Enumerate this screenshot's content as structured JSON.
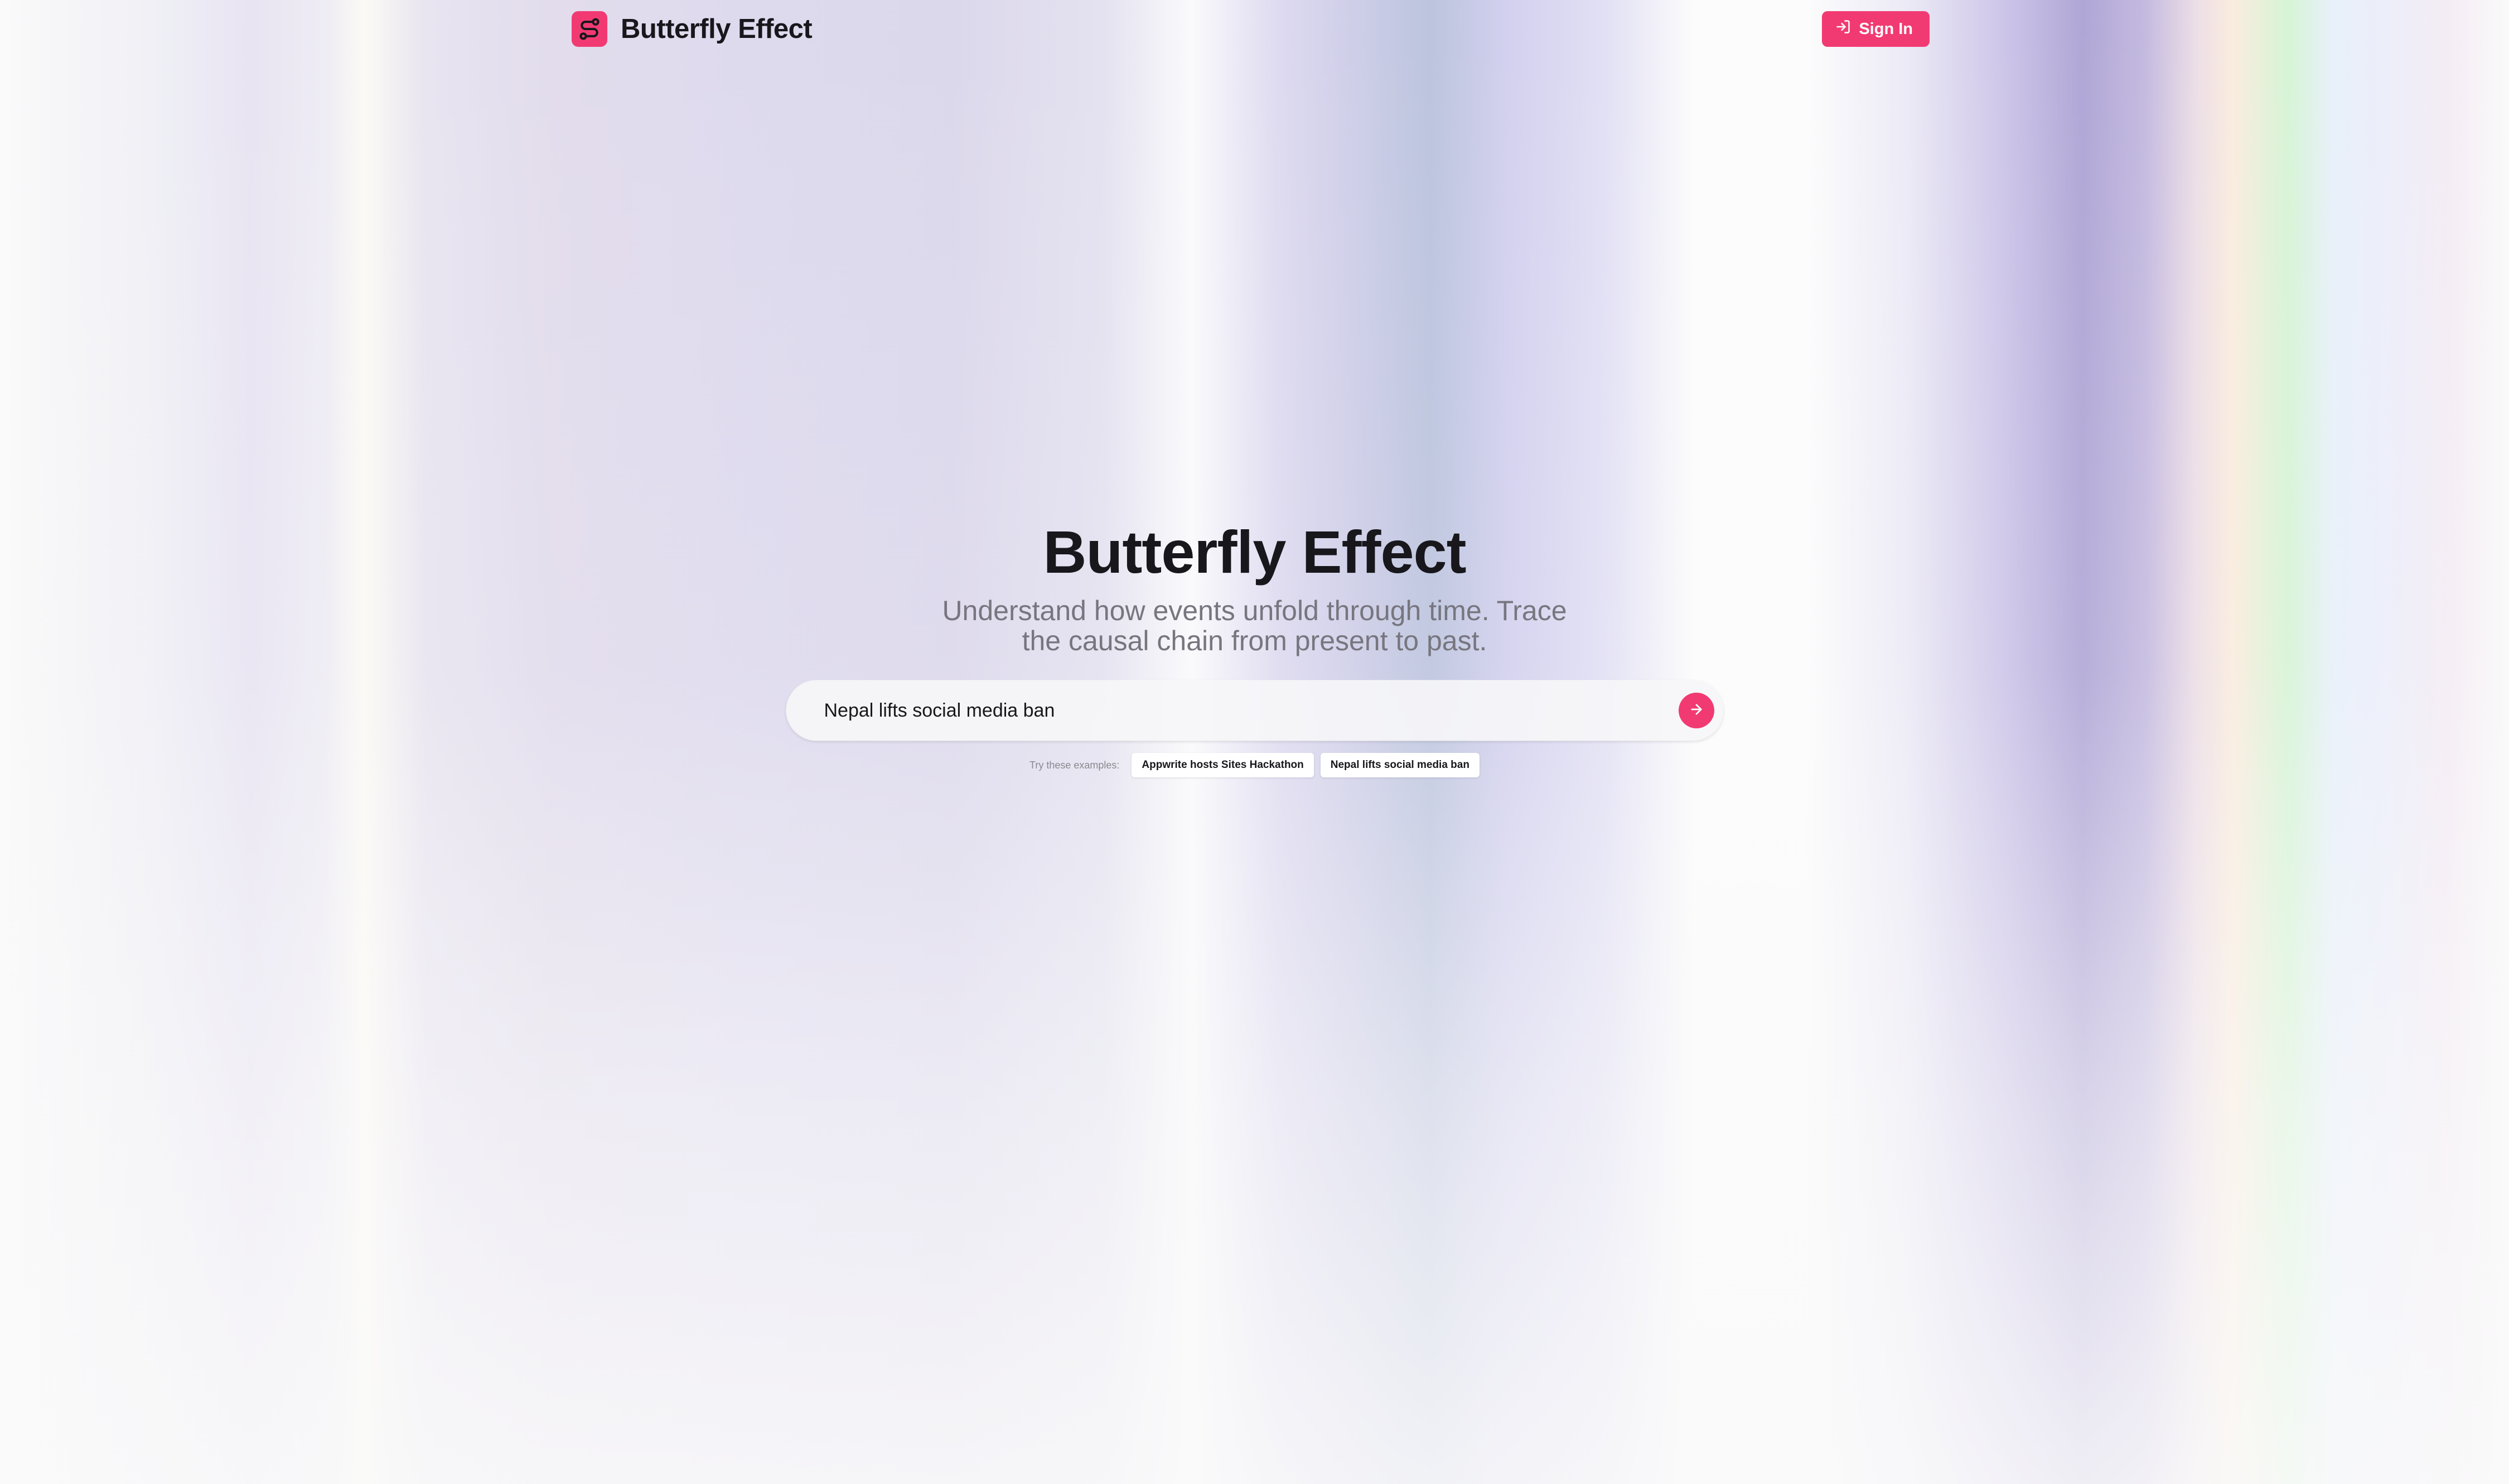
{
  "header": {
    "brand_name": "Butterfly Effect",
    "signin_label": "Sign In"
  },
  "hero": {
    "title": "Butterfly Effect",
    "subtitle": "Understand how events unfold through time. Trace the causal chain from present to past."
  },
  "search": {
    "value": "Nepal lifts social media ban",
    "placeholder": ""
  },
  "examples": {
    "label": "Try these examples:",
    "items": [
      "Appwrite hosts Sites Hackathon",
      "Nepal lifts social media ban"
    ]
  },
  "icons": {
    "logo": "route-icon",
    "signin": "log-in-icon",
    "submit": "arrow-right-icon"
  },
  "colors": {
    "accent": "#f23a72",
    "text": "#17171c",
    "muted": "#77767f",
    "background": "#fafafa"
  }
}
